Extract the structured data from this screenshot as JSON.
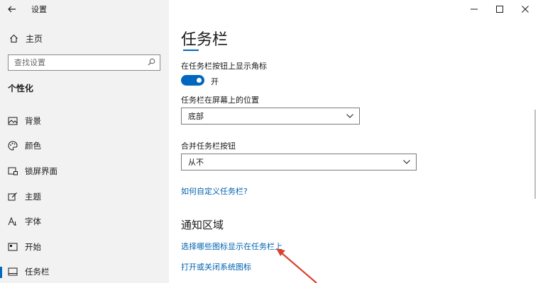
{
  "window": {
    "title": "设置",
    "controls": [
      "minimize",
      "maximize",
      "close"
    ]
  },
  "sidebar": {
    "home_label": "主页",
    "search": {
      "placeholder": "查找设置",
      "value": ""
    },
    "section_heading": "个性化",
    "items": [
      {
        "label": "背景",
        "icon": "picture-icon"
      },
      {
        "label": "颜色",
        "icon": "palette-icon"
      },
      {
        "label": "锁屏界面",
        "icon": "lock-screen-icon"
      },
      {
        "label": "主题",
        "icon": "theme-brush-icon"
      },
      {
        "label": "字体",
        "icon": "font-icon"
      },
      {
        "label": "开始",
        "icon": "start-icon"
      },
      {
        "label": "任务栏",
        "icon": "taskbar-icon",
        "active": true
      }
    ]
  },
  "main": {
    "title": "任务栏",
    "badge_setting": {
      "label": "在任务栏按钮上显示角标",
      "state_text": "开",
      "on": true
    },
    "location_setting": {
      "label": "任务栏在屏幕上的位置",
      "value": "底部"
    },
    "combine_setting": {
      "label": "合并任务栏按钮",
      "value": "从不"
    },
    "customize_link": "如何自定义任务栏?",
    "notification_section": {
      "title": "通知区域",
      "link_select_icons": "选择哪些图标显示在任务栏上",
      "link_system_icons": "打开或关闭系统图标"
    }
  },
  "colors": {
    "accent": "#0067c0",
    "link": "#0062b0",
    "sidebar_bg": "#f2f2f2",
    "annotation_arrow": "#d9432e"
  }
}
